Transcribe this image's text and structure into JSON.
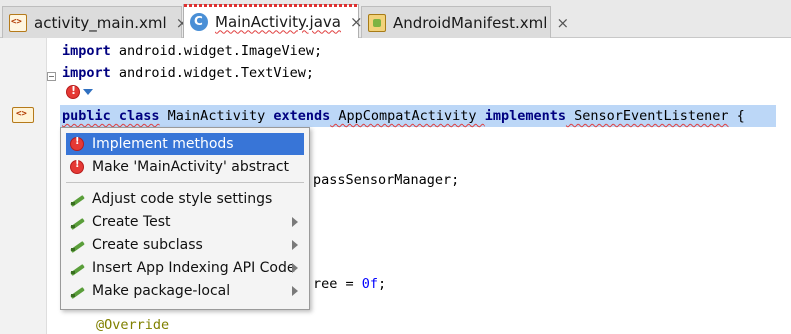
{
  "tabs": [
    {
      "label": "activity_main.xml",
      "icon": "xml-file-icon",
      "active": false
    },
    {
      "label": "MainActivity.java",
      "icon": "java-class-icon",
      "active": true
    },
    {
      "label": "AndroidManifest.xml",
      "icon": "manifest-file-icon",
      "active": false
    }
  ],
  "tab_close_glyph": "×",
  "code": {
    "line1": {
      "kw": "import",
      "rest": " android.widget.ImageView;"
    },
    "line2": {
      "kw": "import",
      "rest": " android.widget.TextView;"
    },
    "class_line": {
      "kw1": "public class",
      "name": " MainActivity ",
      "kw2": "extends",
      "parent": " AppCompatActivity ",
      "kw3": "implements",
      "iface": " SensorEventListener",
      "brace": " {"
    },
    "partial1": "passSensorManager;",
    "partial2": {
      "text": "ree = ",
      "num": "0f",
      "end": ";"
    },
    "annotation": "@Override"
  },
  "popup": {
    "items": [
      {
        "label": "Implement methods",
        "icon": "error-bulb-icon",
        "selected": true,
        "submenu": false
      },
      {
        "label": "Make 'MainActivity' abstract",
        "icon": "error-bulb-icon",
        "selected": false,
        "submenu": false
      },
      {
        "label": "Adjust code style settings",
        "icon": "intention-pen-icon",
        "selected": false,
        "submenu": false
      },
      {
        "label": "Create Test",
        "icon": "intention-pen-icon",
        "selected": false,
        "submenu": true
      },
      {
        "label": "Create subclass",
        "icon": "intention-pen-icon",
        "selected": false,
        "submenu": true
      },
      {
        "label": "Insert App Indexing API Code",
        "icon": "intention-pen-icon",
        "selected": false,
        "submenu": true
      },
      {
        "label": "Make package-local",
        "icon": "intention-pen-icon",
        "selected": false,
        "submenu": true
      }
    ]
  },
  "colors": {
    "selection": "#bcd7f7",
    "menu_selected": "#3875d7",
    "keyword": "#000080",
    "annotation": "#808000",
    "error": "#e53935"
  }
}
